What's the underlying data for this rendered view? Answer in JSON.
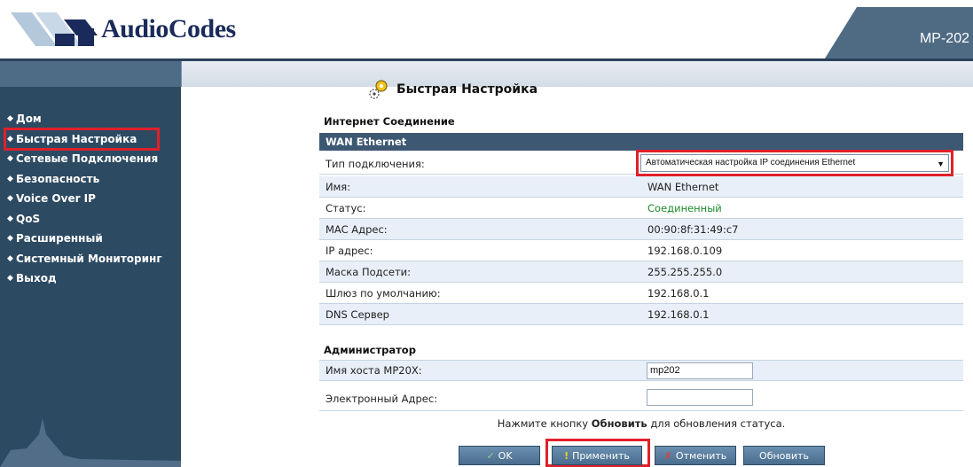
{
  "header": {
    "logo_text": "AudioCodes",
    "model": "MP-202"
  },
  "sidebar": {
    "items": [
      {
        "label": "Дом"
      },
      {
        "label": "Быстрая Настройка",
        "active": true
      },
      {
        "label": "Сетевые Подключения"
      },
      {
        "label": "Безопасность"
      },
      {
        "label": "Voice Over IP"
      },
      {
        "label": "QoS"
      },
      {
        "label": "Расширенный"
      },
      {
        "label": "Системный Мониторинг"
      },
      {
        "label": "Выход"
      }
    ]
  },
  "page": {
    "title": "Быстрая Настройка"
  },
  "internet": {
    "section_title": "Интернет Соединение",
    "bar_title": "WAN Ethernet",
    "rows": [
      {
        "label": "Тип подключения:",
        "value": "Автоматическая настройка IP соединения Ethernet"
      },
      {
        "label": "Имя:",
        "value": "WAN Ethernet"
      },
      {
        "label": "Статус:",
        "value": "Соединенный"
      },
      {
        "label": "MAC Адрес:",
        "value": "00:90:8f:31:49:c7"
      },
      {
        "label": "IP адрес:",
        "value": "192.168.0.109"
      },
      {
        "label": "Маска Подсети:",
        "value": "255.255.255.0"
      },
      {
        "label": "Шлюз по умолчанию:",
        "value": "192.168.0.1"
      },
      {
        "label": "DNS Сервер",
        "value": "192.168.0.1"
      }
    ]
  },
  "admin": {
    "section_title": "Администратор",
    "rows": [
      {
        "label": "Имя хоста MP20X:",
        "value": "mp202"
      },
      {
        "label": "Электронный Адрес:",
        "value": ""
      }
    ]
  },
  "hint": {
    "prefix": "Нажмите кнопку ",
    "bold": "Обновить",
    "suffix": " для обновления статуса."
  },
  "buttons": {
    "ok": "OK",
    "apply": "Применить",
    "cancel": "Отменить",
    "refresh": "Обновить"
  },
  "colors": {
    "sidebar_bg": "#2d4a63",
    "bar_bg": "#3d5873",
    "highlight": "#e0202a",
    "status_green": "#1d8a2a"
  }
}
